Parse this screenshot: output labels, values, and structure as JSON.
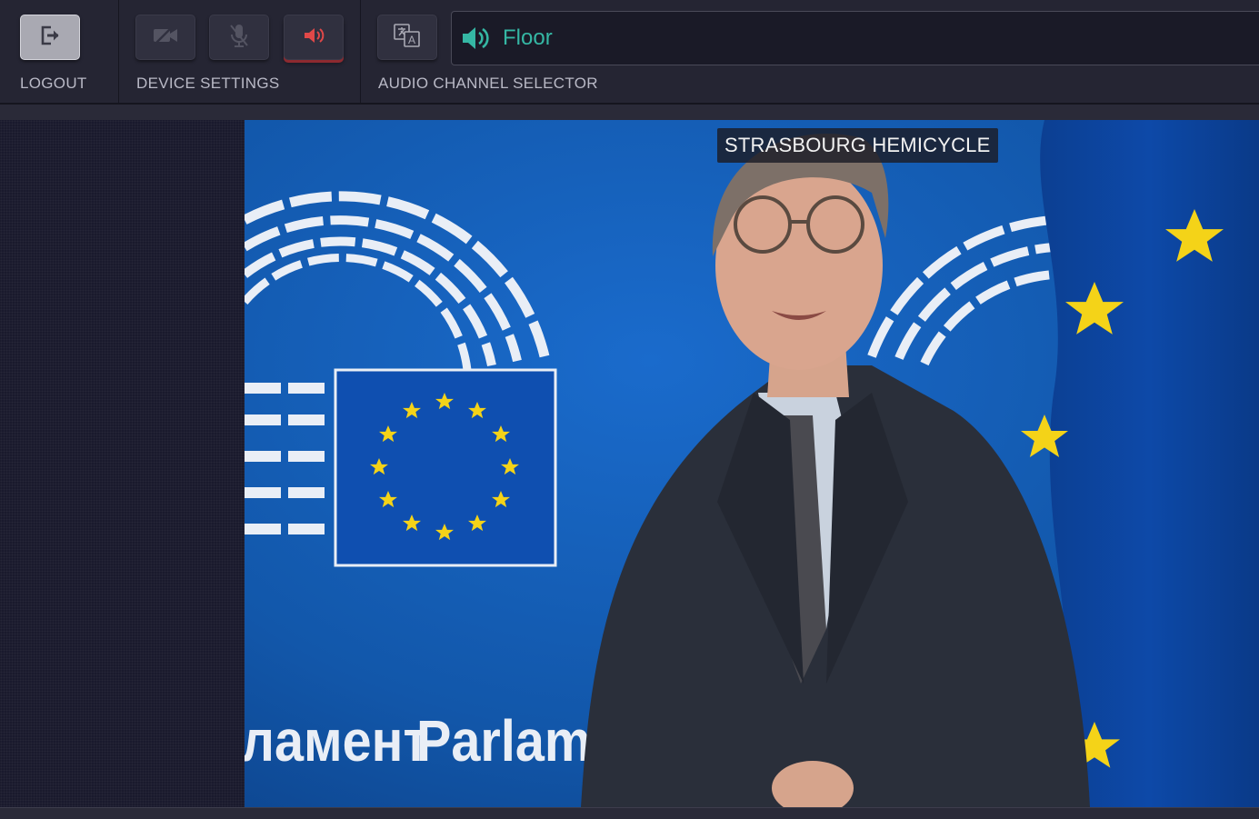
{
  "toolbar": {
    "logout": {
      "label": "LOGOUT",
      "icon": "logout-icon"
    },
    "device_settings": {
      "label": "DEVICE SETTINGS",
      "camera_icon": "camera-off-icon",
      "mic_icon": "mic-off-icon",
      "speaker_icon": "speaker-on-icon"
    },
    "audio_channel": {
      "label": "AUDIO CHANNEL SELECTOR",
      "translate_icon": "translate-icon",
      "selected": "Floor",
      "speaker_icon": "speaker-icon"
    }
  },
  "video": {
    "channel_badge": "STRASBOURG HEMICYCLE",
    "backdrop_text_cyrillic": "ламент",
    "backdrop_text_latin": "Parlamer"
  },
  "colors": {
    "accent_teal": "#35b7a4",
    "speaker_red": "#e04848",
    "toolbar_bg": "#252533",
    "panel_bg": "#1a1a2d"
  }
}
